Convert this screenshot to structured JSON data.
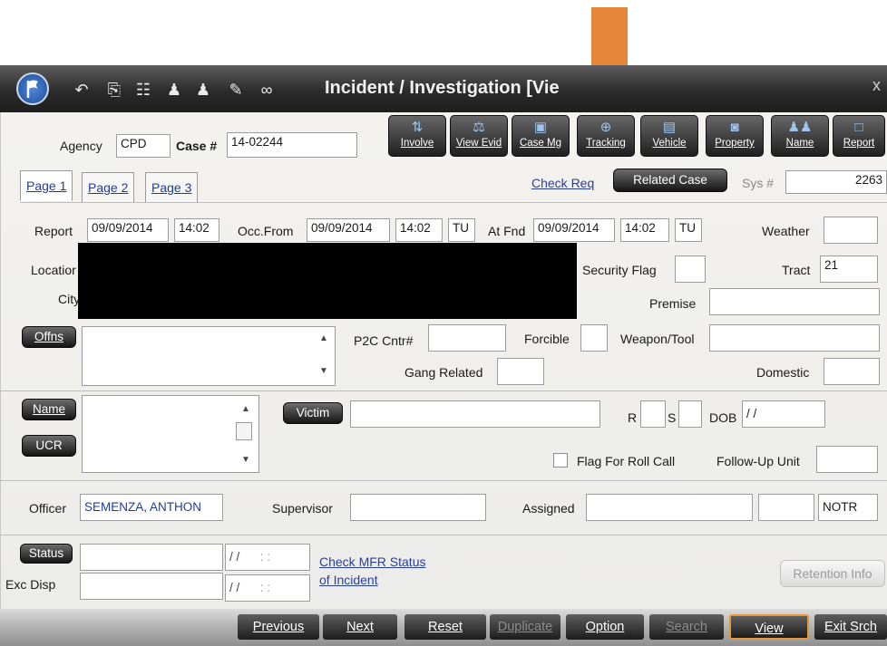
{
  "window": {
    "title": "Incident / Investigation [Vie"
  },
  "toolbar_icons": [
    "back-arrow-icon",
    "paperclip-icon",
    "form-icon",
    "person-icon",
    "person-icon",
    "pencil-icon",
    "link-icon"
  ],
  "modules": [
    {
      "label": "Involve",
      "icon": "involve-icon"
    },
    {
      "label": "View Evid",
      "icon": "evidence-icon"
    },
    {
      "label": "Case Mg",
      "icon": "case-management-icon"
    },
    {
      "label": "Tracking",
      "icon": "tracking-icon"
    },
    {
      "label": "Vehicle",
      "icon": "vehicle-icon"
    },
    {
      "label": "Property",
      "icon": "camera-icon"
    },
    {
      "label": "Name",
      "icon": "people-icon"
    },
    {
      "label": "Report",
      "icon": "report-icon"
    }
  ],
  "header": {
    "agency_label": "Agency",
    "agency_value": "CPD",
    "case_label": "Case #",
    "case_value": "14-02244"
  },
  "tabs": [
    "Page 1",
    "Page 2",
    "Page 3"
  ],
  "links": {
    "check_req": "Check Req",
    "check_mfr_line1": "Check MFR Status",
    "check_mfr_line2": "of Incident"
  },
  "related_case_button": "Related Case",
  "sys": {
    "label": "Sys #",
    "value": "2263"
  },
  "report": {
    "label": "Report",
    "date": "09/09/2014",
    "time": "14:02",
    "occ_from_label": "Occ.From",
    "occ_from_date": "09/09/2014",
    "occ_from_time": "14:02",
    "occ_from_day": "TU",
    "at_fnd_label": "At Fnd",
    "at_fnd_date": "09/09/2014",
    "at_fnd_time": "14:02",
    "at_fnd_day": "TU",
    "weather_label": "Weather"
  },
  "location": {
    "location_label": "Locatior",
    "city_label": "City",
    "security_flag_label": "Security Flag",
    "tract_label": "Tract",
    "tract_value": "21",
    "premise_label": "Premise"
  },
  "offenses": {
    "offns_button": "Offns",
    "p2c_label": "P2C Cntr#",
    "forcible_label": "Forcible",
    "weapon_label": "Weapon/Tool",
    "gang_label": "Gang Related",
    "domestic_label": "Domestic"
  },
  "names": {
    "name_button": "Name",
    "ucr_button": "UCR",
    "victim_button": "Victim",
    "r_label": "R",
    "s_label": "S",
    "dob_label": "DOB",
    "dob_value": "/ /",
    "flag_roll_call_label": "Flag For Roll Call",
    "follow_up_label": "Follow-Up Unit"
  },
  "officer": {
    "officer_label": "Officer",
    "officer_value": "SEMENZA, ANTHON",
    "supervisor_label": "Supervisor",
    "assigned_label": "Assigned",
    "notr_value": "NOTR"
  },
  "status": {
    "status_button": "Status",
    "exc_disp_label": "Exc Disp",
    "date_placeholder_1": "/ /",
    "time_placeholder_1": ": :",
    "date_placeholder_2": "/ /",
    "time_placeholder_2": ": :",
    "retention_button": "Retention Info"
  },
  "footer": {
    "buttons": [
      {
        "label": "Previous",
        "enabled": true
      },
      {
        "label": "Next",
        "enabled": true
      },
      {
        "label": "Reset",
        "enabled": true
      },
      {
        "label": "Duplicate",
        "enabled": false
      },
      {
        "label": "Option",
        "enabled": true
      },
      {
        "label": "Search",
        "enabled": false
      },
      {
        "label": "View",
        "enabled": true
      },
      {
        "label": "Exit Srch",
        "enabled": true
      }
    ]
  },
  "colors": {
    "annotation_arrow": "#e8873a",
    "link": "#2a3f9a",
    "focus_outline": "#e8963a"
  }
}
